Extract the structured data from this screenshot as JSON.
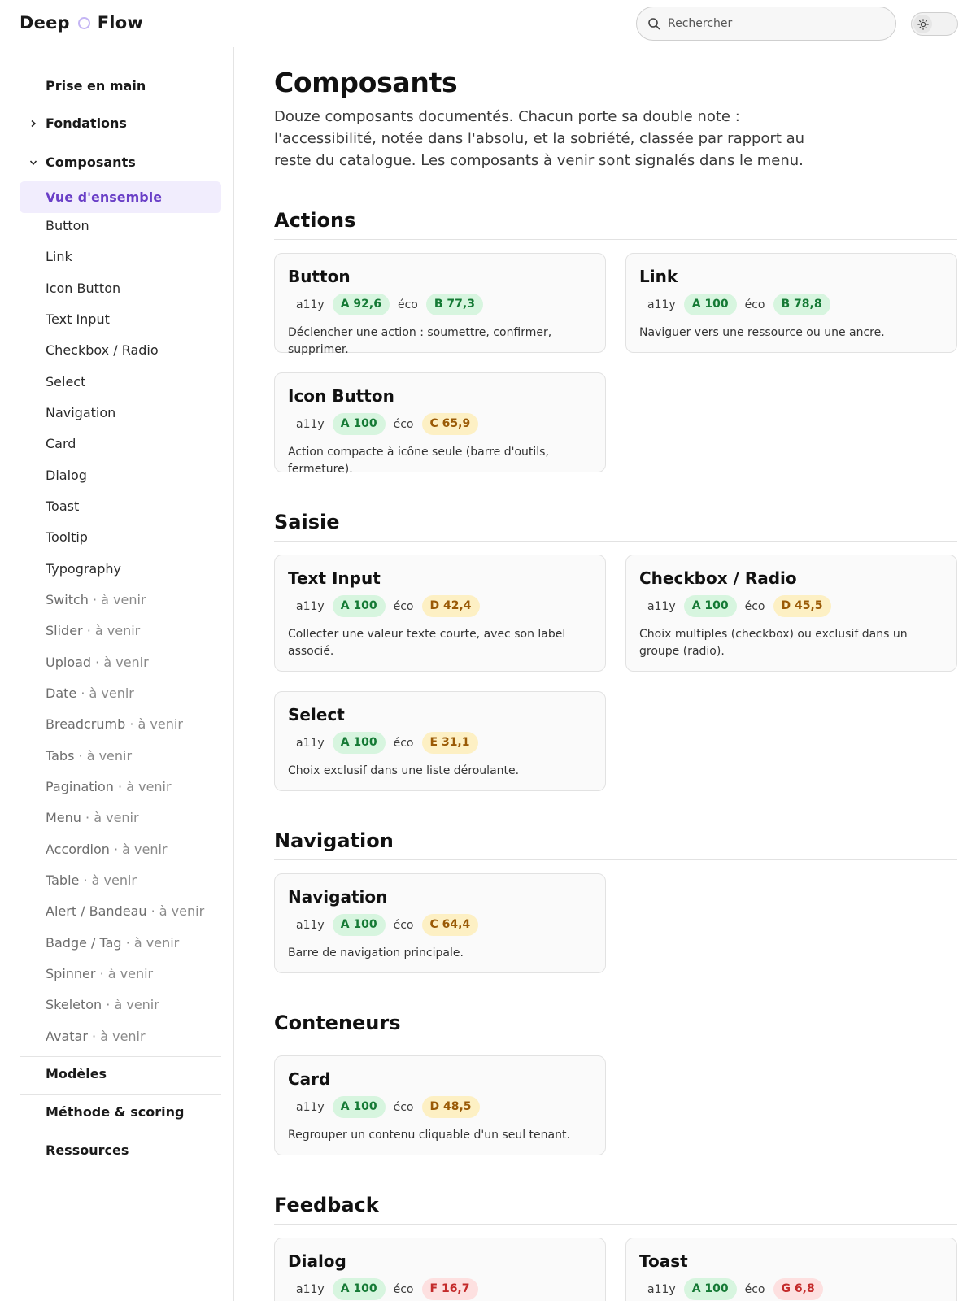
{
  "header": {
    "logo_left": "Deep",
    "logo_right": "Flow",
    "search_placeholder": "Rechercher"
  },
  "sidebar": {
    "prise_en_main": "Prise en main",
    "fondations": "Fondations",
    "composants": "Composants",
    "active_item": "Vue d'ensemble",
    "items": [
      {
        "label": "Button"
      },
      {
        "label": "Link"
      },
      {
        "label": "Icon Button"
      },
      {
        "label": "Text Input"
      },
      {
        "label": "Checkbox / Radio"
      },
      {
        "label": "Select"
      },
      {
        "label": "Navigation"
      },
      {
        "label": "Card"
      },
      {
        "label": "Dialog"
      },
      {
        "label": "Toast"
      },
      {
        "label": "Tooltip"
      },
      {
        "label": "Typography"
      }
    ],
    "upcoming_suffix": "· à venir",
    "upcoming": [
      {
        "label": "Switch"
      },
      {
        "label": "Slider"
      },
      {
        "label": "Upload"
      },
      {
        "label": "Date"
      },
      {
        "label": "Breadcrumb"
      },
      {
        "label": "Tabs"
      },
      {
        "label": "Pagination"
      },
      {
        "label": "Menu"
      },
      {
        "label": "Accordion"
      },
      {
        "label": "Table"
      },
      {
        "label": "Alert / Bandeau"
      },
      {
        "label": "Badge / Tag"
      },
      {
        "label": "Spinner"
      },
      {
        "label": "Skeleton"
      },
      {
        "label": "Avatar"
      }
    ],
    "modeles": "Modèles",
    "methode": "Méthode & scoring",
    "ressources": "Ressources"
  },
  "main": {
    "title": "Composants",
    "intro": "Douze composants documentés. Chacun porte sa double note : l'accessibilité, notée dans l'absolu, et la sobriété, classée par rapport au reste du catalogue. Les composants à venir sont signalés dans le menu.",
    "a11y_label": "a11y",
    "eco_label": "éco",
    "groups": [
      {
        "title": "Actions"
      },
      {
        "title": "Saisie"
      },
      {
        "title": "Navigation"
      },
      {
        "title": "Conteneurs"
      },
      {
        "title": "Feedback"
      }
    ],
    "cards": [
      {
        "title": "Button",
        "a11y": "A 92,6",
        "eco": "B 77,3",
        "eco_level": "g",
        "desc": "Déclencher une action : soumettre, confirmer, supprimer."
      },
      {
        "title": "Link",
        "a11y": "A 100",
        "eco": "B 78,8",
        "eco_level": "g",
        "desc": "Naviguer vers une ressource ou une ancre."
      },
      {
        "title": "Icon Button",
        "a11y": "A 100",
        "eco": "C 65,9",
        "eco_level": "y",
        "desc": "Action compacte à icône seule (barre d'outils, fermeture)."
      },
      {
        "title": "Text Input",
        "a11y": "A 100",
        "eco": "D 42,4",
        "eco_level": "y",
        "desc": "Collecter une valeur texte courte, avec son label associé."
      },
      {
        "title": "Checkbox / Radio",
        "a11y": "A 100",
        "eco": "D 45,5",
        "eco_level": "y",
        "desc": "Choix multiples (checkbox) ou exclusif dans un groupe (radio)."
      },
      {
        "title": "Select",
        "a11y": "A 100",
        "eco": "E 31,1",
        "eco_level": "y",
        "desc": "Choix exclusif dans une liste déroulante."
      },
      {
        "title": "Navigation",
        "a11y": "A 100",
        "eco": "C 64,4",
        "eco_level": "y",
        "desc": "Barre de navigation principale."
      },
      {
        "title": "Card",
        "a11y": "A 100",
        "eco": "D 48,5",
        "eco_level": "y",
        "desc": "Regrouper un contenu cliquable d'un seul tenant."
      },
      {
        "title": "Dialog",
        "a11y": "A 100",
        "eco": "F 16,7",
        "eco_level": "r",
        "desc": ""
      },
      {
        "title": "Toast",
        "a11y": "A 100",
        "eco": "G 6,8",
        "eco_level": "r",
        "desc": ""
      }
    ]
  },
  "colors": {
    "accent": "#6a3fc7",
    "active_bg": "#f1edfd",
    "pill_green": "#d7f5df",
    "pill_yellow": "#fdf0c4",
    "pill_red": "#fde0e0"
  }
}
